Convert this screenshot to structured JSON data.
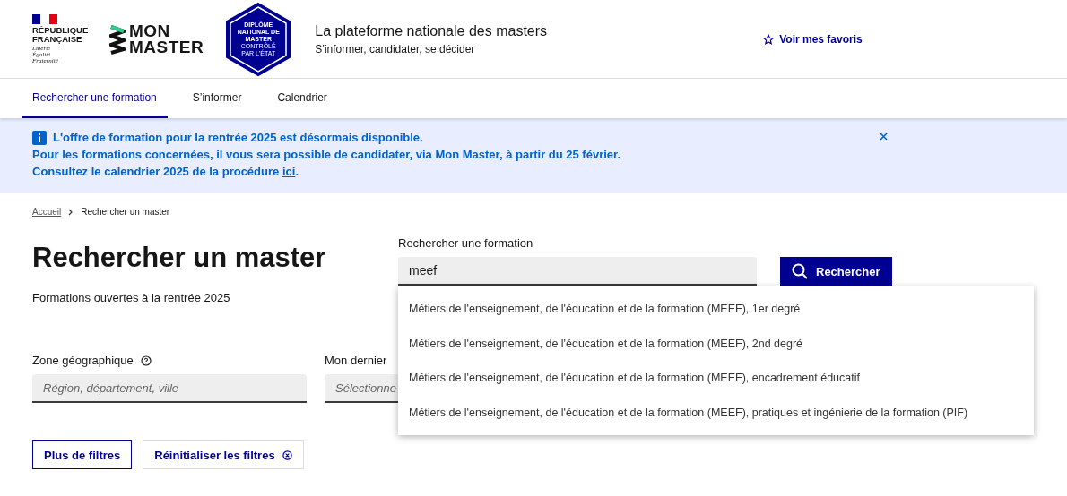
{
  "header": {
    "marianne": {
      "name": "RÉPUBLIQUE FRANÇAISE",
      "motto": [
        "Liberté",
        "Égalité",
        "Fraternité"
      ]
    },
    "logo": [
      "MON",
      "MASTER"
    ],
    "badge": [
      "DIPLÔME",
      "NATIONAL DE",
      "MASTER",
      "CONTRÔLÉ",
      "PAR L'ÉTAT"
    ],
    "title": "La plateforme nationale des masters",
    "subtitle": "S’informer, candidater, se décider",
    "favorites": "Voir mes favoris"
  },
  "nav": [
    {
      "label": "Rechercher une formation",
      "selected": true
    },
    {
      "label": "S’informer",
      "selected": false
    },
    {
      "label": "Calendrier",
      "selected": false
    }
  ],
  "notice": {
    "lines": [
      "L'offre de formation pour la rentrée 2025 est désormais disponible.",
      "Pour les formations concernées, il vous sera possible de candidater, via Mon Master, à partir du 25 février."
    ],
    "last_line": "Consultez le calendrier 2025 de la procédure",
    "link": "ici",
    "after_link": "."
  },
  "breadcrumb": [
    {
      "label": "Accueil",
      "kind": "link"
    },
    {
      "label": "Rechercher un master",
      "kind": "current"
    }
  ],
  "page_title": "Rechercher un master",
  "page_subtitle": "Formations ouvertes à la rentrée 2025",
  "search": {
    "label": "Rechercher une formation",
    "value": "meef",
    "button": "Rechercher"
  },
  "suggestions": [
    "Métiers de l'enseignement, de l'éducation et de la formation (MEEF), 1er degré",
    "Métiers de l'enseignement, de l'éducation et de la formation (MEEF), 2nd degré",
    "Métiers de l'enseignement, de l'éducation et de la formation (MEEF), encadrement éducatif",
    "Métiers de l'enseignement, de l'éducation et de la formation (MEEF), pratiques et ingénierie de la formation (PIF)"
  ],
  "filters": [
    {
      "label": "Zone géographique",
      "help": true,
      "placeholder": "Région, département, ville"
    },
    {
      "label": "Mon dernier",
      "help": false,
      "placeholder": "Sélectionne"
    }
  ],
  "buttons": [
    {
      "label": "Plus de filtres",
      "kind": "outline"
    },
    {
      "label": "Réinitialiser les filtres",
      "kind": "tertiary"
    }
  ]
}
